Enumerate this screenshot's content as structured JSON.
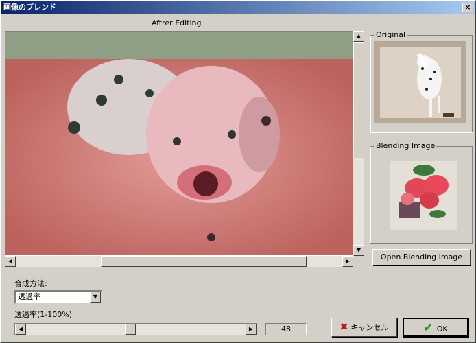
{
  "window": {
    "title": "画像のブレンド",
    "close_glyph": "×"
  },
  "preview": {
    "heading": "Aftrer Editing"
  },
  "original": {
    "legend": "Original"
  },
  "blending": {
    "legend": "Blending Image",
    "open_button": "Open Blending Image"
  },
  "composition": {
    "method_label": "合成方法:",
    "method_value": "透過率",
    "opacity_label": "透過率(1-100%)",
    "opacity_value": "48",
    "opacity_min": 1,
    "opacity_max": 100
  },
  "buttons": {
    "cancel": "キャンセル",
    "ok": "OK",
    "cancel_icon": "x-icon",
    "ok_icon": "checkmark-icon"
  },
  "scroll_glyphs": {
    "up": "▲",
    "down": "▼",
    "left": "◀",
    "right": "▶"
  },
  "colors": {
    "title_start": "#0a246a",
    "title_end": "#a6caf0",
    "face": "#d4d0c8",
    "cancel_x": "#c01818",
    "ok_check": "#0a9a1a"
  }
}
